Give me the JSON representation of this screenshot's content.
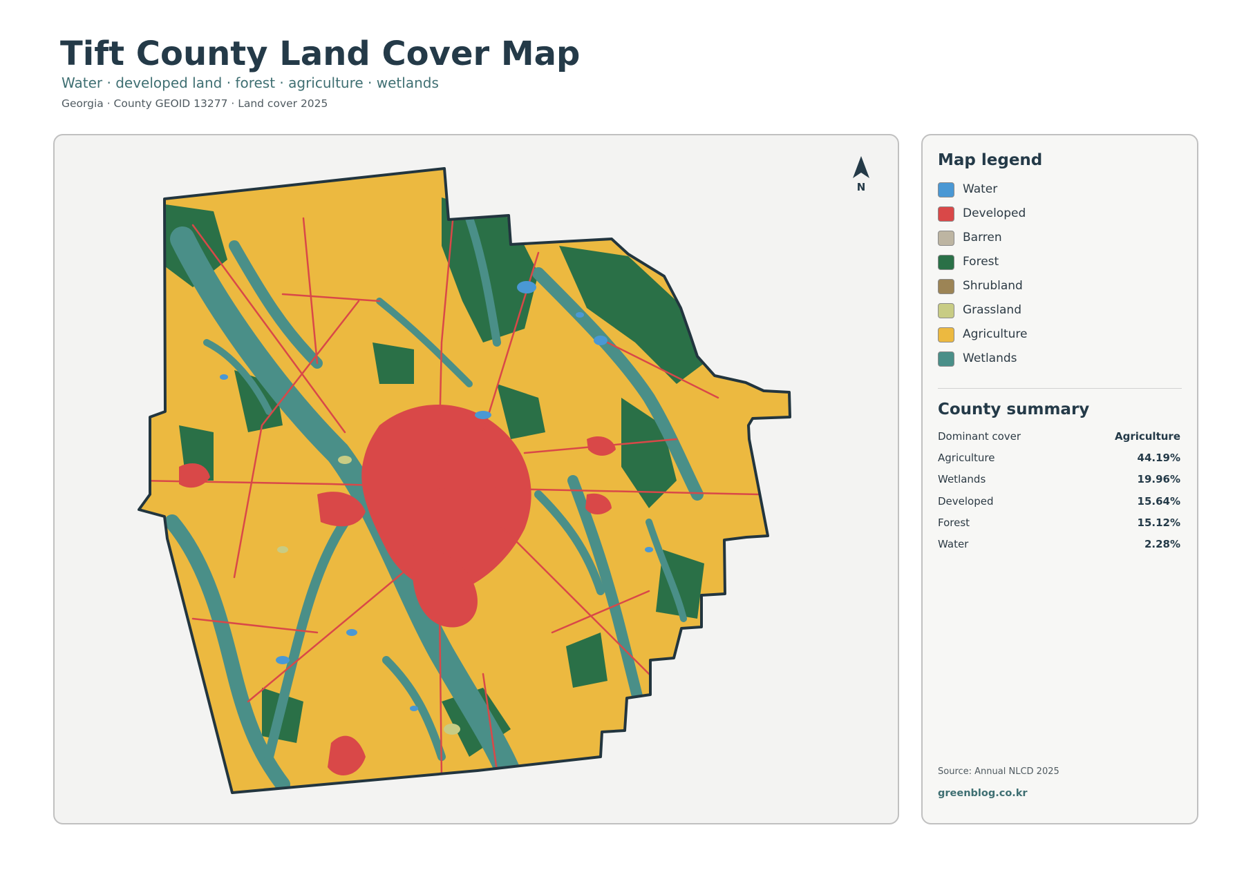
{
  "header": {
    "title": "Tift County Land Cover Map",
    "subtitle": "Water · developed land · forest · agriculture · wetlands",
    "meta": "Georgia · County GEOID 13277 · Land cover 2025"
  },
  "north_arrow": {
    "label": "N"
  },
  "legend": {
    "title": "Map legend",
    "items": [
      {
        "label": "Water",
        "color": "#4a98d4"
      },
      {
        "label": "Developed",
        "color": "#d94848"
      },
      {
        "label": "Barren",
        "color": "#bdb5a2"
      },
      {
        "label": "Forest",
        "color": "#2a7047"
      },
      {
        "label": "Shrubland",
        "color": "#9c8455"
      },
      {
        "label": "Grassland",
        "color": "#c8cc84"
      },
      {
        "label": "Agriculture",
        "color": "#ecb940"
      },
      {
        "label": "Wetlands",
        "color": "#4a8f88"
      }
    ]
  },
  "summary": {
    "title": "County summary",
    "rows": [
      {
        "key": "Dominant cover",
        "value": "Agriculture"
      },
      {
        "key": "Agriculture",
        "value": "44.19%"
      },
      {
        "key": "Wetlands",
        "value": "19.96%"
      },
      {
        "key": "Developed",
        "value": "15.64%"
      },
      {
        "key": "Forest",
        "value": "15.12%"
      },
      {
        "key": "Water",
        "value": "2.28%"
      }
    ]
  },
  "footer": {
    "source": "Source: Annual NLCD 2025",
    "credit": "greenblog.co.kr"
  }
}
